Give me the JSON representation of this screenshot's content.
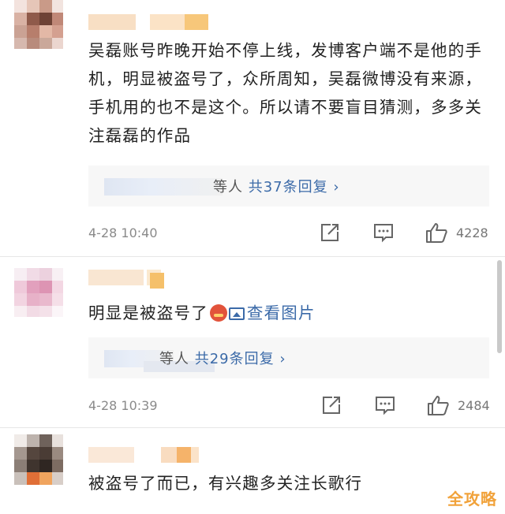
{
  "comments": [
    {
      "text": "吴磊账号昨晚开始不停上线，发博客户端不是他的手机，明显被盗号了，众所周知，吴磊微博没有来源，手机用的也不是这个。所以请不要盲目猜测，多多关注磊磊的作品",
      "replies_prefix": "等人",
      "replies_count": "共37条回复 ›",
      "time": "4-28 10:40",
      "likes": "4228"
    },
    {
      "text": "明显是被盗号了",
      "view_pics": "查看图片",
      "replies_prefix": "等人",
      "replies_count": "共29条回复 ›",
      "time": "4-28 10:39",
      "likes": "2484"
    },
    {
      "text": "被盗号了而已，有兴趣多关注长歌行"
    }
  ],
  "icons": {
    "repost": "repost-icon",
    "comment": "comment-icon",
    "like": "thumbs-up-icon",
    "emoji": "angry-face-emoji-icon",
    "image": "image-icon"
  },
  "watermark": "全攻略",
  "colors": {
    "link": "#3b6aa8",
    "reply_box": "#f7f7f7",
    "meta": "#8a8a8a",
    "watermark": "#f1a23a"
  }
}
